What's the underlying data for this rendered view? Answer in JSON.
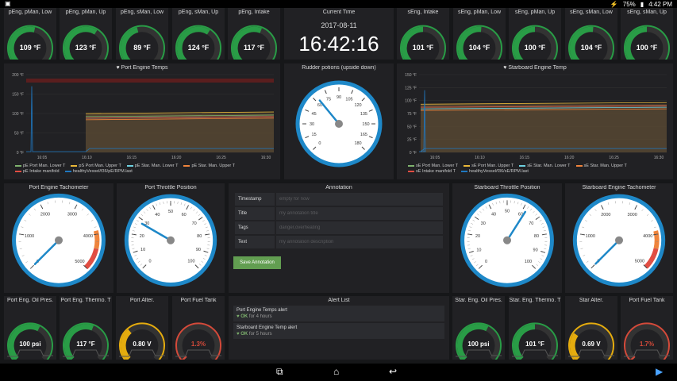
{
  "statusbar": {
    "battery": "75%",
    "time": "4:42 PM"
  },
  "top_gauges_left": [
    {
      "title": "pEng, pMan, Low",
      "value": "109 °F",
      "frac": 0.55
    },
    {
      "title": "pEng, pMan, Up",
      "value": "123 °F",
      "frac": 0.62
    },
    {
      "title": "pEng, sMan, Low",
      "value": "89 °F",
      "frac": 0.45
    },
    {
      "title": "pEng, sMan, Up",
      "value": "124 °F",
      "frac": 0.62
    },
    {
      "title": "pEng, Intake",
      "value": "117 °F",
      "frac": 0.58
    }
  ],
  "top_gauges_right": [
    {
      "title": "sEng, Intake",
      "value": "101 °F",
      "frac": 0.5
    },
    {
      "title": "sEng, pMan, Low",
      "value": "104 °F",
      "frac": 0.52
    },
    {
      "title": "sEng, pMan, Up",
      "value": "100 °F",
      "frac": 0.5
    },
    {
      "title": "sEng, sMan, Low",
      "value": "104 °F",
      "frac": 0.52
    },
    {
      "title": "sEng, sMan, Up",
      "value": "100 °F",
      "frac": 0.5
    }
  ],
  "clock": {
    "title": "Current Time",
    "date": "2017-08-11",
    "time": "16:42:16"
  },
  "port_chart": {
    "title": "Port Engine Temps",
    "yticks": [
      "200 °F",
      "150 °F",
      "100 °F",
      "50 °F",
      "0 °F"
    ],
    "xticks": [
      "16:05",
      "16:10",
      "16:15",
      "16:20",
      "16:25",
      "16:30"
    ],
    "legend": [
      {
        "label": "pE Port Man. Lower T",
        "color": "#7eb26d"
      },
      {
        "label": "pS Port Man. Upper T",
        "color": "#eab839"
      },
      {
        "label": "pE Star. Man. Lower T",
        "color": "#6ed0e0"
      },
      {
        "label": "pE Star. Man. Upper T",
        "color": "#ef843c"
      },
      {
        "label": "pE Intake manifold",
        "color": "#e24d42"
      },
      {
        "label": "healthyVessel/f36/pE/RPM.last",
        "color": "#1f78c1"
      }
    ]
  },
  "rudder": {
    "title": "Rudder potions (upside down)",
    "value": "63.75",
    "ticks": [
      "0",
      "15",
      "30",
      "45",
      "60",
      "75",
      "90",
      "105",
      "120",
      "135",
      "150",
      "165",
      "180"
    ]
  },
  "star_chart": {
    "title": "Starboard Engine Temp",
    "yticks": [
      "150 °F",
      "125 °F",
      "100 °F",
      "75 °F",
      "50 °F",
      "25 °F",
      "0 °F"
    ],
    "xticks": [
      "16:05",
      "16:10",
      "16:15",
      "16:20",
      "16:25",
      "16:30"
    ],
    "legend": [
      {
        "label": "sE Port Man. Lower T",
        "color": "#7eb26d"
      },
      {
        "label": "sE Port Man. Upper T",
        "color": "#eab839"
      },
      {
        "label": "sE Star. Man. Lower T",
        "color": "#6ed0e0"
      },
      {
        "label": "sE Star. Man. Upper T",
        "color": "#ef843c"
      },
      {
        "label": "sE Intake manifold T",
        "color": "#e24d42"
      },
      {
        "label": "healthyVessel/f36/sE/RPM.last",
        "color": "#1f78c1"
      }
    ]
  },
  "port_tach": {
    "title": "Port Engine Tachometer",
    "value": "0 rpm",
    "ticks": [
      "0",
      "1000",
      "2000",
      "3000",
      "4000",
      "5000"
    ],
    "needle": 0.0
  },
  "port_throttle": {
    "title": "Port Throttle Position",
    "value": "27.79",
    "ticks": [
      "0",
      "10",
      "20",
      "30",
      "40",
      "50",
      "60",
      "70",
      "80",
      "90",
      "100"
    ],
    "needle": 0.278
  },
  "annotation": {
    "title": "Annotation",
    "rows": [
      {
        "label": "Timestamp",
        "placeholder": "empty for now"
      },
      {
        "label": "Title",
        "placeholder": "my annotation title"
      },
      {
        "label": "Tags",
        "placeholder": "danger,overheating"
      },
      {
        "label": "Text",
        "placeholder": "my annotation description"
      }
    ],
    "button": "Save Annotation"
  },
  "star_throttle": {
    "title": "Starboard Throttle Position",
    "value": "N/A",
    "ticks": [
      "0",
      "10",
      "20",
      "30",
      "40",
      "50",
      "60",
      "70",
      "80",
      "90",
      "100"
    ],
    "needle": 0.62
  },
  "star_tach": {
    "title": "Starboard Engine Tachometer",
    "value": "0 rpm",
    "ticks": [
      "0",
      "1000",
      "2000",
      "3000",
      "4000",
      "5000"
    ],
    "needle": 0.0
  },
  "bottom_left": [
    {
      "title": "Port Eng. Oil Pres.",
      "value": "100 psi",
      "frac": 0.6,
      "color": "#299c46",
      "vcolor": "#fff"
    },
    {
      "title": "Port Eng. Thermo. T",
      "value": "117 °F",
      "frac": 0.58,
      "color": "#299c46",
      "vcolor": "#fff"
    },
    {
      "title": "Port Alter.",
      "value": "0.80 V",
      "frac": 0.35,
      "color": "#e5ac0e",
      "vcolor": "#fff"
    },
    {
      "title": "Port Fuel Tank",
      "value": "1.3%",
      "frac": 0.02,
      "color": "#d44a3a",
      "vcolor": "#d44a3a"
    }
  ],
  "alerts": {
    "title": "Alert List",
    "items": [
      {
        "name": "Port Engine Temps alert",
        "state": "OK",
        "since": "for 4 hours"
      },
      {
        "name": "Starboard Engine Temp alert",
        "state": "OK",
        "since": "for 5 hours"
      }
    ]
  },
  "bottom_right": [
    {
      "title": "Star. Eng. Oil Pres.",
      "value": "100 psi",
      "frac": 0.6,
      "color": "#299c46",
      "vcolor": "#fff"
    },
    {
      "title": "Star. Eng. Thermo. T",
      "value": "101 °F",
      "frac": 0.5,
      "color": "#299c46",
      "vcolor": "#fff"
    },
    {
      "title": "Star Alter.",
      "value": "0.69 V",
      "frac": 0.3,
      "color": "#e5ac0e",
      "vcolor": "#fff"
    },
    {
      "title": "Port Fuel Tank",
      "value": "1.7%",
      "frac": 0.02,
      "color": "#d44a3a",
      "vcolor": "#d44a3a"
    }
  ]
}
